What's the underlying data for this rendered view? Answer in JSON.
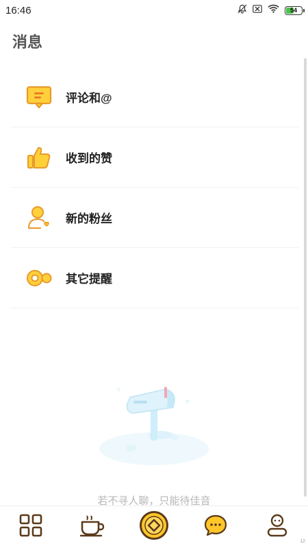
{
  "status_bar": {
    "time": "16:46",
    "battery_level": "54",
    "battery_fraction": 0.54,
    "icons": [
      "mute-icon",
      "sim-off-icon",
      "wifi-icon",
      "battery-icon"
    ]
  },
  "page": {
    "title": "消息"
  },
  "menu": {
    "items": [
      {
        "label": "评论和@",
        "icon": "comment-icon"
      },
      {
        "label": "收到的赞",
        "icon": "thumbs-up-icon"
      },
      {
        "label": "新的粉丝",
        "icon": "new-follower-icon"
      },
      {
        "label": "其它提醒",
        "icon": "other-reminder-icon"
      }
    ]
  },
  "empty_state": {
    "text": "若不寻人聊，只能待佳音",
    "illustration": "mailbox-illustration"
  },
  "tab_bar": {
    "tabs": [
      {
        "icon": "grid-icon"
      },
      {
        "icon": "coffee-cup-icon"
      },
      {
        "icon": "center-diamond-icon"
      },
      {
        "icon": "chat-bubble-icon"
      },
      {
        "icon": "profile-icon"
      }
    ],
    "corner_number": "12"
  },
  "colors": {
    "accent_yellow": "#ffc629",
    "accent_brown": "#5a3a1a",
    "text_primary": "#222222",
    "text_muted": "#b7b7b7"
  }
}
